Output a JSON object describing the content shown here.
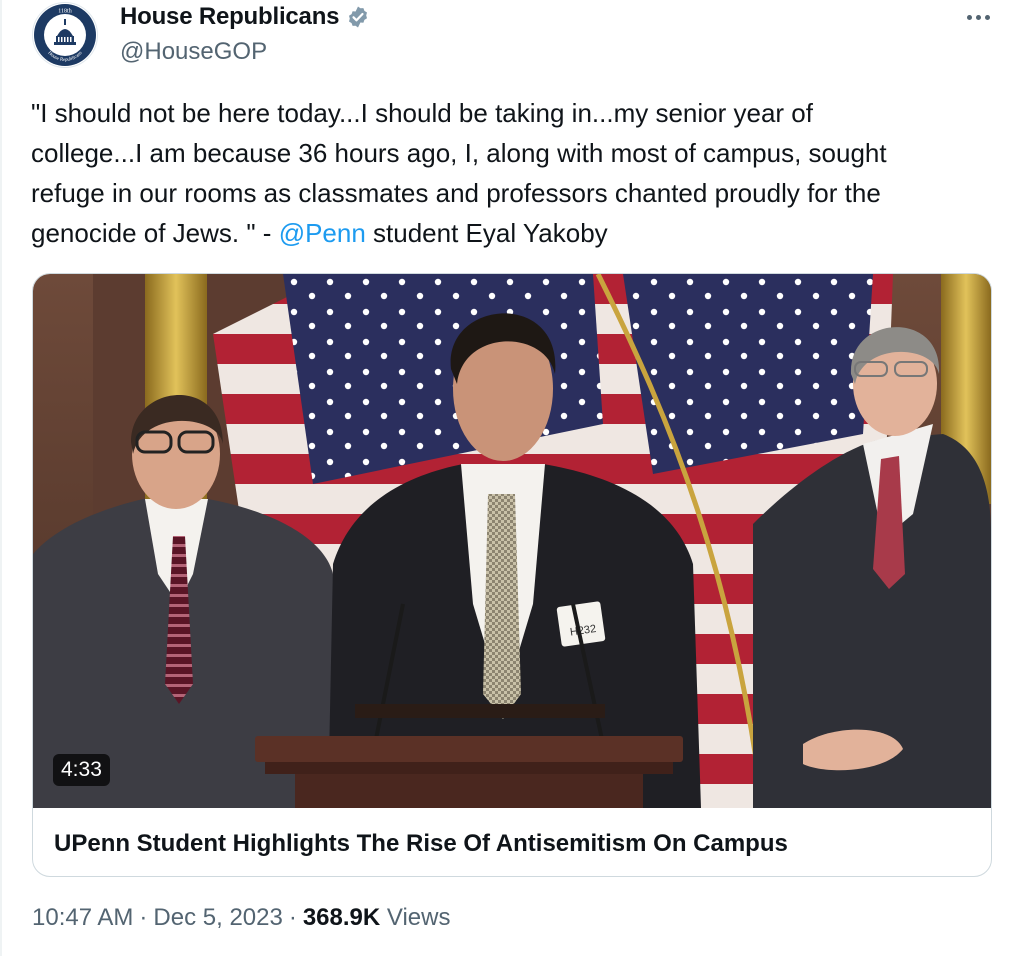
{
  "author": {
    "display_name": "House Republicans",
    "handle": "@HouseGOP",
    "verified": true,
    "avatar_seal_top": "118th",
    "avatar_seal_bottom": "House Republicans"
  },
  "tweet": {
    "lines": [
      "\"I should not be here today...I should be taking in...my senior year of",
      "college...I am because 36 hours ago, I, along with most of campus, sought",
      "refuge in our rooms as classmates and professors chanted proudly for the"
    ],
    "last_line_prefix": "genocide of Jews. \" - ",
    "mention": "@Penn",
    "last_line_suffix": " student Eyal Yakoby"
  },
  "media": {
    "duration": "4:33",
    "title": "UPenn Student Highlights The Rise Of Antisemitism On Campus",
    "badge_text": "H232"
  },
  "meta": {
    "time": "10:47 AM",
    "separator": "·",
    "date": "Dec 5, 2023",
    "views_count": "368.9K",
    "views_label": "Views"
  },
  "colors": {
    "link": "#1d9bf0",
    "secondary_text": "#536471",
    "verified_badge": "#829aab",
    "border": "#cfd9de"
  }
}
